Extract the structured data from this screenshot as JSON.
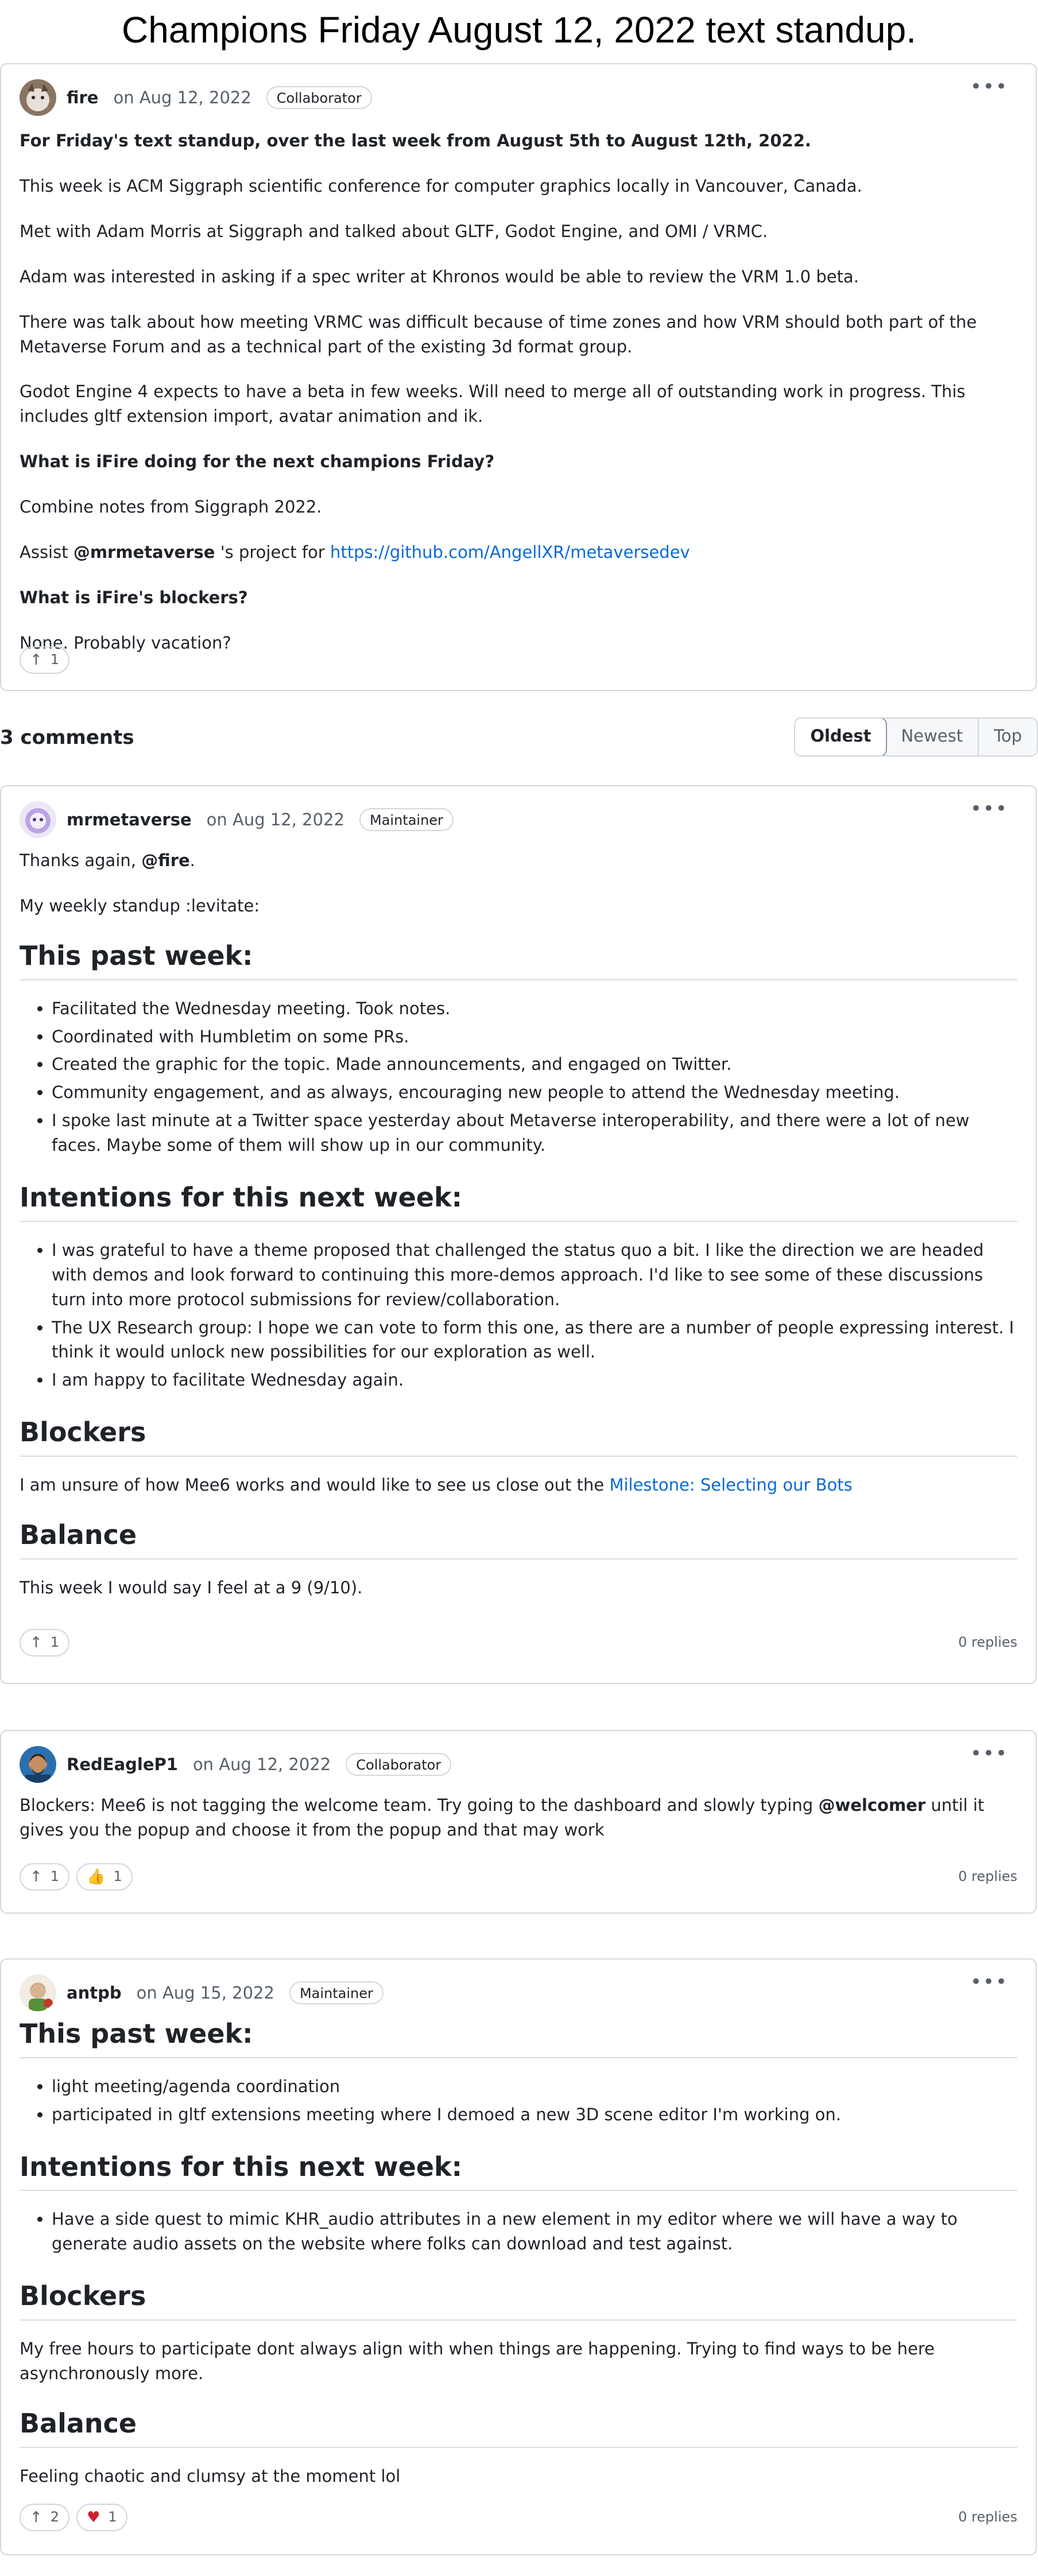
{
  "page": {
    "title": "Champions Friday August 12, 2022 text standup."
  },
  "post": {
    "author": "fire",
    "date": "on Aug 12, 2022",
    "badge": "Collaborator",
    "intro": "For Friday's text standup, over the last week from August 5th to August 12th, 2022.",
    "p1": "This week is ACM Siggraph scientific conference for computer graphics locally in Vancouver, Canada.",
    "p2": "Met with Adam Morris at Siggraph and talked about GLTF, Godot Engine, and OMI / VRMC.",
    "p3": "Adam was interested in asking if a spec writer at Khronos would be able to review the VRM 1.0 beta.",
    "p4": "There was talk about how meeting VRMC was difficult because of time zones and how VRM should both part of the Metaverse Forum and as a technical part of the existing 3d format group.",
    "p5": "Godot Engine 4 expects to have a beta in few weeks. Will need to merge all of outstanding work in progress. This includes gltf extension import, avatar animation and ik.",
    "q1": "What is iFire doing for the next champions Friday?",
    "p6": "Combine notes from Siggraph 2022.",
    "assist_pre": "Assist",
    "assist_mention": "@mrmetaverse",
    "assist_mid": "'s project for",
    "assist_link": "https://github.com/AngellXR/metaversedev",
    "q2": "What is iFire's blockers?",
    "p7": "None. Probably vacation?",
    "upvotes": "1"
  },
  "comments_header": {
    "title": "3 comments",
    "sort": [
      "Oldest",
      "Newest",
      "Top"
    ]
  },
  "c1": {
    "author": "mrmetaverse",
    "date": "on Aug 12, 2022",
    "badge": "Maintainer",
    "thanks_pre": "Thanks again,",
    "thanks_mention": "@fire",
    "thanks_post": ".",
    "line2": "My weekly standup :levitate:",
    "h_past": "This past week:",
    "past": [
      "Facilitated the Wednesday meeting. Took notes.",
      "Coordinated with Humbletim on some PRs.",
      "Created the graphic for the topic. Made announcements, and engaged on Twitter.",
      "Community engagement, and as always, encouraging new people to attend the Wednesday meeting.",
      "I spoke last minute at a Twitter space yesterday about Metaverse interoperability, and there were a lot of new faces. Maybe some of them will show up in our community."
    ],
    "h_next": "Intentions for this next week:",
    "next": [
      "I was grateful to have a theme proposed that challenged the status quo a bit. I like the direction we are headed with demos and look forward to continuing this more-demos approach. I'd like to see some of these discussions turn into more protocol submissions for review/collaboration.",
      "The UX Research group: I hope we can vote to form this one, as there are a number of people expressing interest. I think it would unlock new possibilities for our exploration as well.",
      "I am happy to facilitate Wednesday again."
    ],
    "h_block": "Blockers",
    "block_pre": "I am unsure of how Mee6 works and would like to see us close out the",
    "block_link": "Milestone: Selecting our Bots",
    "h_bal": "Balance",
    "balance": "This week I would say I feel at a 9 (9/10).",
    "upvotes": "1",
    "replies": "0 replies"
  },
  "c2": {
    "author": "RedEagleP1",
    "date": "on Aug 12, 2022",
    "badge": "Collaborator",
    "text_pre": "Blockers: Mee6 is not tagging the welcome team. Try going to the dashboard and slowly typing",
    "text_mention": "@welcomer",
    "text_post": "until it gives you the popup and choose it from the popup and that may work",
    "upvotes": "1",
    "thumbs": "1",
    "replies": "0 replies"
  },
  "c3": {
    "author": "antpb",
    "date": "on Aug 15, 2022",
    "badge": "Maintainer",
    "h_past": "This past week:",
    "past": [
      "light meeting/agenda coordination",
      "participated in gltf extensions meeting where I demoed a new 3D scene editor I'm working on."
    ],
    "h_next": "Intentions for this next week:",
    "next": [
      "Have a side quest to mimic KHR_audio attributes in a new element in my editor where we will have a way to generate audio assets on the website where folks can download and test against."
    ],
    "h_block": "Blockers",
    "blockers": "My free hours to participate dont always align with when things are happening. Trying to find ways to be here asynchronously more.",
    "h_bal": "Balance",
    "balance": "Feeling chaotic and clumsy at the moment lol",
    "upvotes": "2",
    "hearts": "1",
    "replies": "0 replies"
  },
  "icons": {
    "upvote": "arrow-up-icon",
    "thumbs": "thumbs-up-icon",
    "heart": "heart-icon",
    "more": "kebab-icon"
  },
  "colors": {
    "link": "#0969da",
    "border": "#d0d7de",
    "muted": "#57606a",
    "heart": "#cf222e"
  }
}
